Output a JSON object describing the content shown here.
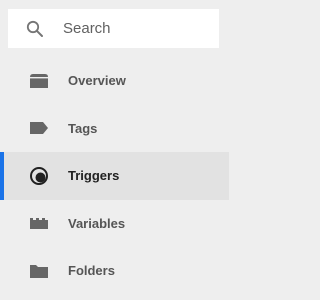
{
  "search": {
    "placeholder": "Search",
    "value": "",
    "icon": "search-icon"
  },
  "nav": {
    "active_index": 2,
    "accent_color": "#1a73e8",
    "items": [
      {
        "label": "Overview",
        "icon": "overview-icon"
      },
      {
        "label": "Tags",
        "icon": "tag-icon"
      },
      {
        "label": "Triggers",
        "icon": "trigger-icon"
      },
      {
        "label": "Variables",
        "icon": "variables-icon"
      },
      {
        "label": "Folders",
        "icon": "folder-icon"
      }
    ]
  }
}
